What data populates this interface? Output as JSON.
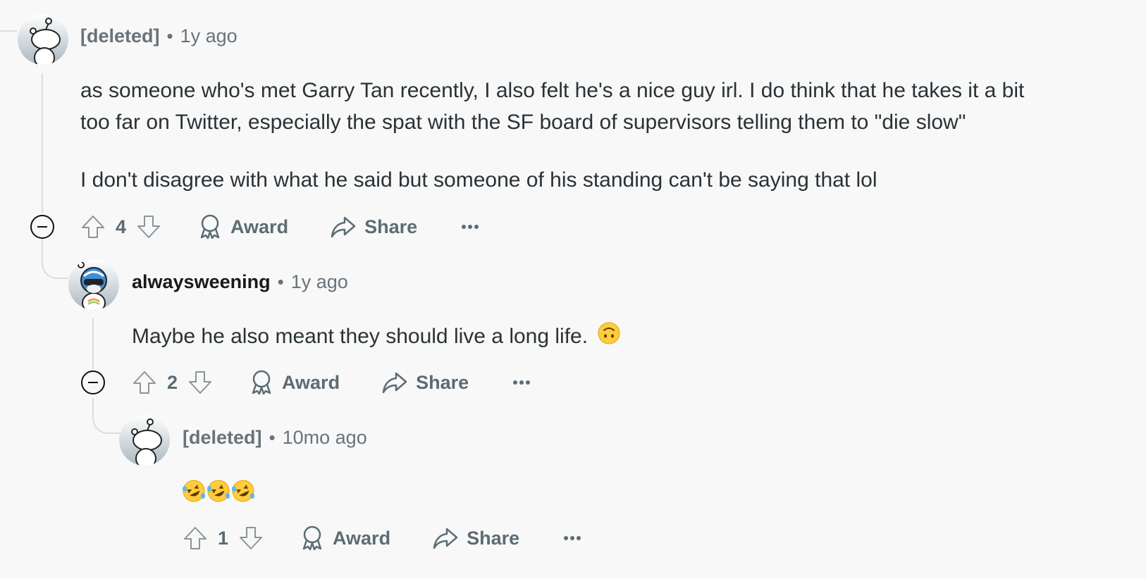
{
  "comments": [
    {
      "author": "[deleted]",
      "separator": "•",
      "time": "1y ago",
      "paragraphs": [
        "as someone who's met Garry Tan recently, I also felt he's a nice guy irl. I do think that he takes it a bit",
        "too far on Twitter, especially the spat with the SF board of supervisors telling them to \"die slow\"",
        "I don't disagree with what he said but someone of his standing can't be saying that lol"
      ],
      "score": "4",
      "award_label": "Award",
      "share_label": "Share"
    },
    {
      "author": "alwaysweening",
      "separator": "•",
      "time": "1y ago",
      "text": "Maybe he also meant they should live a long life.",
      "emoji_icon": "upside-down-face-icon",
      "score": "2",
      "award_label": "Award",
      "share_label": "Share"
    },
    {
      "author": "[deleted]",
      "separator": "•",
      "time": "10mo ago",
      "emoji_icons": [
        "rolling-on-floor-laughing-icon",
        "rolling-on-floor-laughing-icon",
        "rolling-on-floor-laughing-icon"
      ],
      "score": "1",
      "award_label": "Award",
      "share_label": "Share"
    }
  ],
  "colors": {
    "background": "#f8f8f8",
    "text": "#2a3236",
    "muted": "#68737a",
    "action": "#5c6c74",
    "thread_line": "#d9dde0"
  }
}
